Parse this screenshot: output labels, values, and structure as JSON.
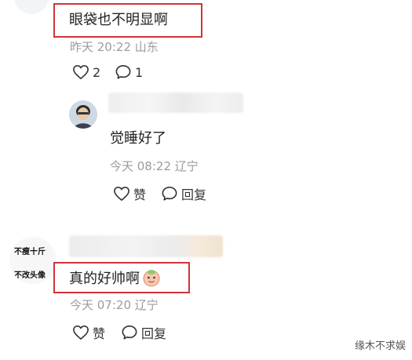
{
  "comment1": {
    "text": "眼袋也不明显啊",
    "time": "昨天 20:22",
    "location": "山东",
    "likes": "2",
    "replies": "1"
  },
  "reply1": {
    "text": "觉睡好了",
    "time": "今天 08:22",
    "location": "辽宁",
    "like_label": "赞",
    "reply_label": "回复"
  },
  "comment2": {
    "avatar_line1": "不瘦十斤",
    "avatar_line2": "不改头像",
    "text": "真的好帅啊",
    "time": "今天 07:20",
    "location": "辽宁",
    "like_label": "赞",
    "reply_label": "回复"
  },
  "watermark": "缘木不求娱",
  "colors": {
    "highlight_border": "#d0343a",
    "meta_text": "#9b9b9b"
  }
}
